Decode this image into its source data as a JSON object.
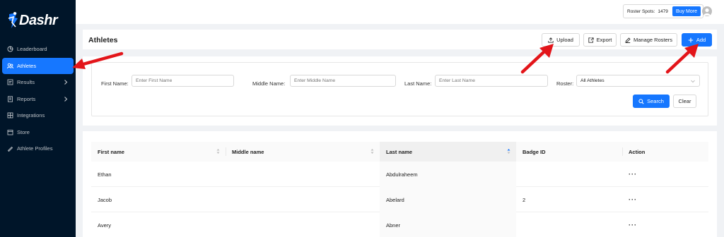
{
  "app": {
    "name": "Dashr"
  },
  "colors": {
    "sidebar": "#001529",
    "primary": "#1677ff",
    "annotation_arrow": "#e3151a"
  },
  "sidebar": {
    "items": [
      {
        "label": "Leaderboard",
        "icon": "leaderboard-icon",
        "active": false,
        "expandable": false
      },
      {
        "label": "Athletes",
        "icon": "athletes-icon",
        "active": true,
        "expandable": false
      },
      {
        "label": "Results",
        "icon": "results-icon",
        "active": false,
        "expandable": true
      },
      {
        "label": "Reports",
        "icon": "reports-icon",
        "active": false,
        "expandable": true
      },
      {
        "label": "Integrations",
        "icon": "integrations-icon",
        "active": false,
        "expandable": false
      },
      {
        "label": "Store",
        "icon": "store-icon",
        "active": false,
        "expandable": false
      },
      {
        "label": "Athlete Profiles",
        "icon": "athlete-profiles-icon",
        "active": false,
        "expandable": false
      }
    ]
  },
  "topbar": {
    "roster_spots_label": "Roster Spots:",
    "roster_spots_value": "1479",
    "buy_more_label": "Buy More",
    "avatar_icon": "user-avatar-icon"
  },
  "header": {
    "title": "Athletes",
    "buttons": {
      "upload": "Upload",
      "export": "Export",
      "manage_rosters": "Manage Rosters",
      "add": "Add"
    }
  },
  "filters": {
    "first_name": {
      "label": "First Name",
      "colon": ":",
      "placeholder": "Enter First Name"
    },
    "middle_name": {
      "label": "Middle Name",
      "colon": ":",
      "placeholder": "Enter Middle Name"
    },
    "last_name": {
      "label": "Last Name",
      "colon": ":",
      "placeholder": "Enter Last Name"
    },
    "roster": {
      "label": "Roster",
      "colon": ":",
      "selected": "All Athletes"
    },
    "search_label": "Search",
    "clear_label": "Clear"
  },
  "table": {
    "columns": [
      "First name",
      "Middle name",
      "Last name",
      "Badge ID",
      "Action"
    ],
    "sorted_column": "Last name",
    "rows": [
      {
        "first": "Ethan",
        "middle": "",
        "last": "Abdulraheem",
        "badge": "",
        "action": "···"
      },
      {
        "first": "Jacob",
        "middle": "",
        "last": "Abelard",
        "badge": "2",
        "action": "···"
      },
      {
        "first": "Avery",
        "middle": "",
        "last": "Abner",
        "badge": "",
        "action": "···"
      }
    ]
  }
}
